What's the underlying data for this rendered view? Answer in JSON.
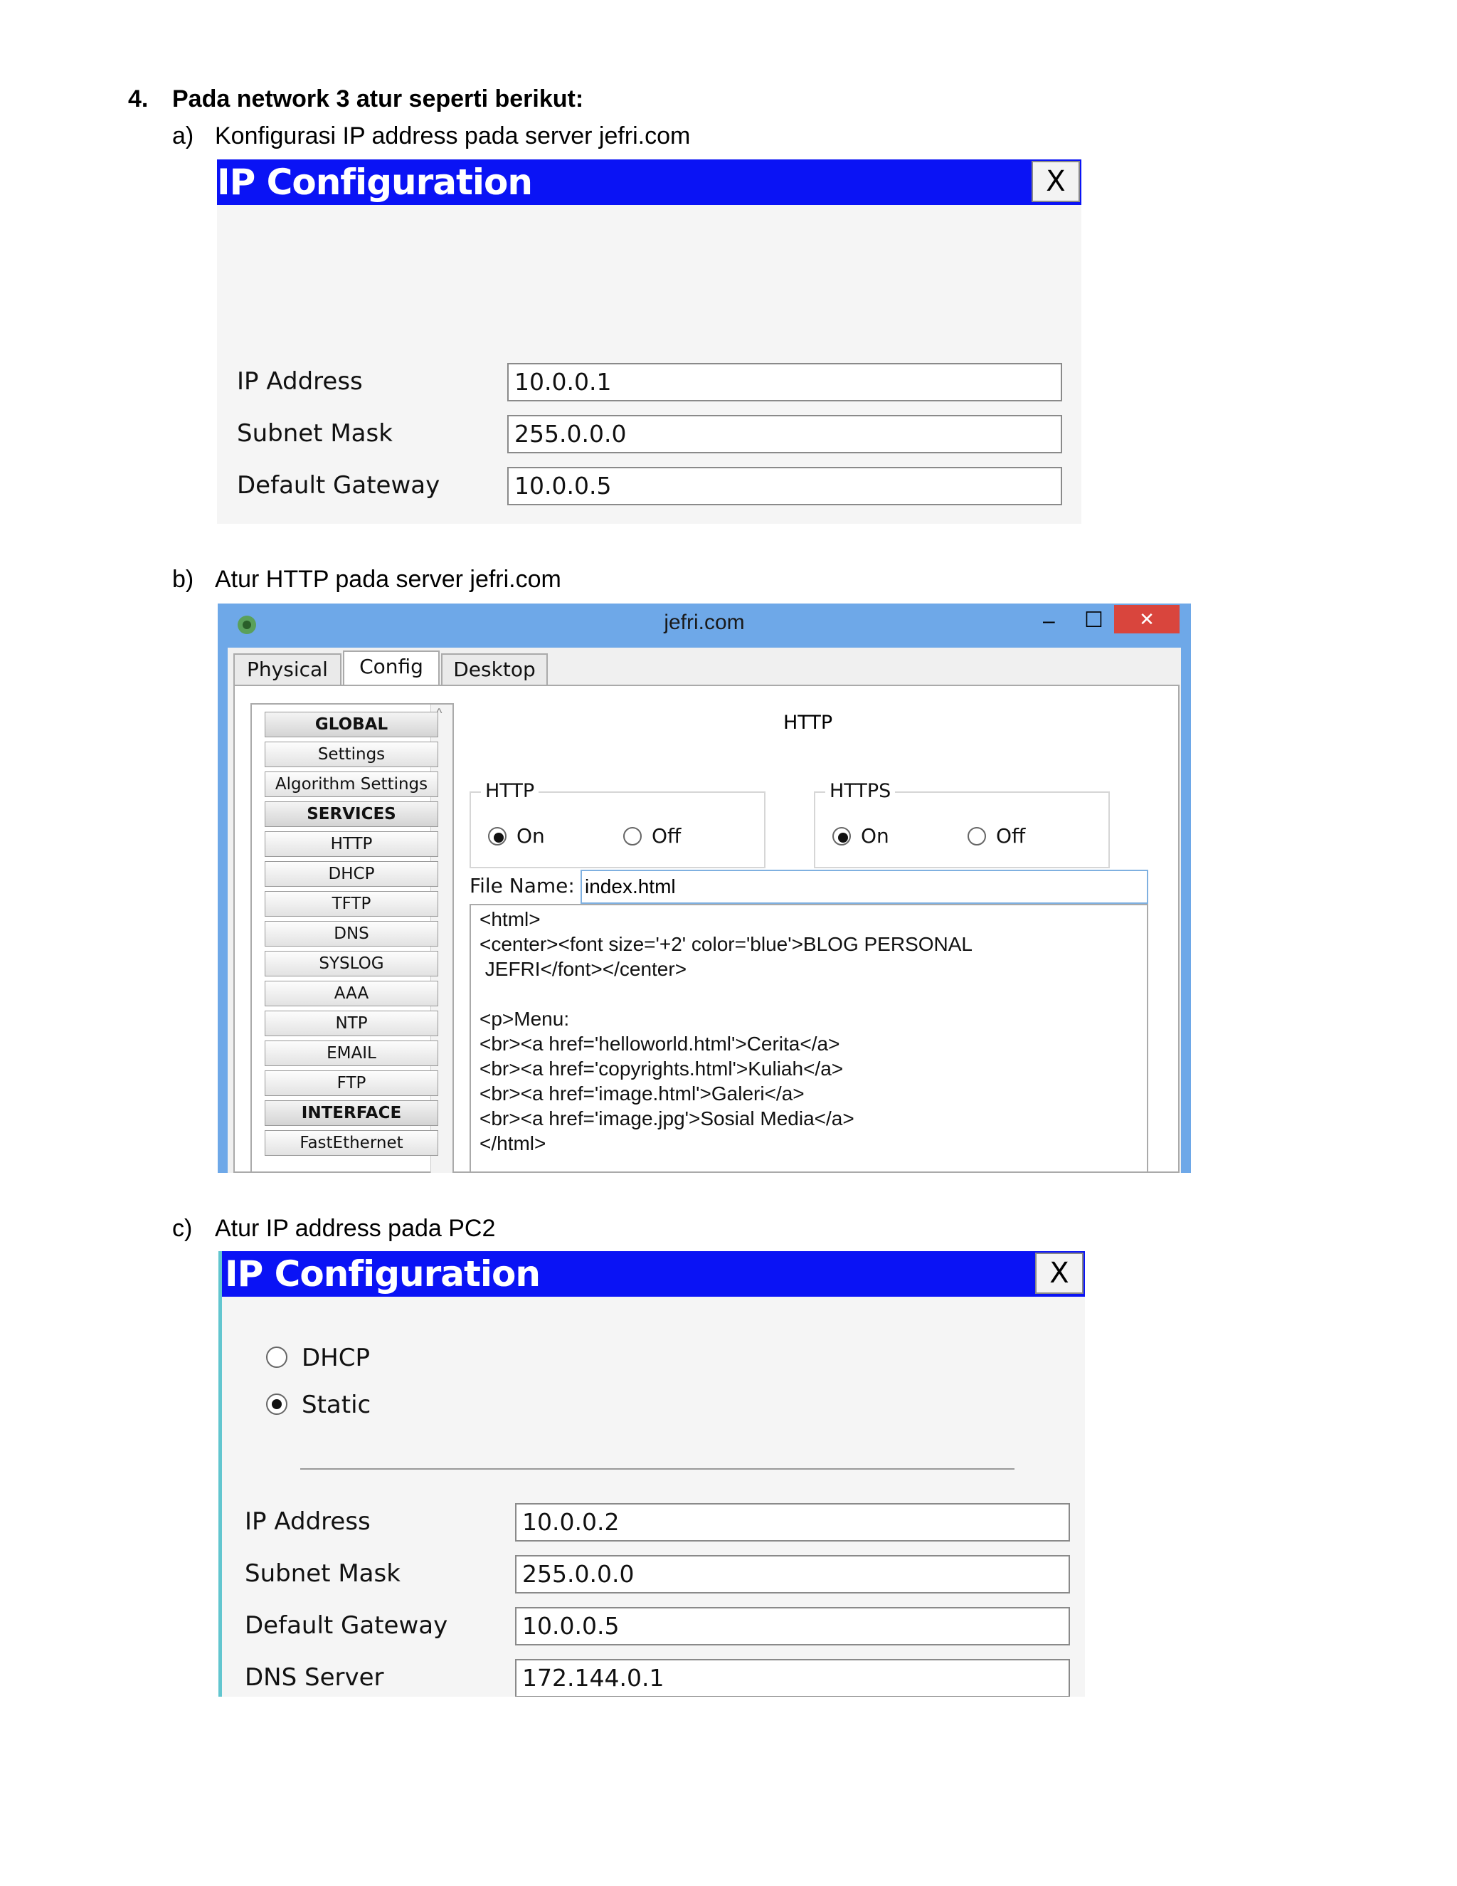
{
  "heading": {
    "number": "4.",
    "text": "Pada network 3 atur seperti berikut:"
  },
  "items": [
    {
      "letter": "a)",
      "text": "Konfigurasi IP address pada server jefri.com"
    },
    {
      "letter": "b)",
      "text": "Atur HTTP pada server jefri.com"
    },
    {
      "letter": "c)",
      "text": "Atur IP address pada PC2"
    }
  ],
  "ip_server": {
    "title": "IP Configuration",
    "close": "X",
    "fields": [
      {
        "label": "IP Address",
        "value": "10.0.0.1"
      },
      {
        "label": "Subnet Mask",
        "value": "255.0.0.0"
      },
      {
        "label": "Default Gateway",
        "value": "10.0.0.5"
      }
    ]
  },
  "pt_window": {
    "title": "jefri.com",
    "controls": {
      "minimize": "‒",
      "maximize": "☐",
      "close": "✕"
    },
    "tabs": [
      "Physical",
      "Config",
      "Desktop"
    ],
    "active_tab": "Config",
    "sidebar": [
      "GLOBAL",
      "Settings",
      "Algorithm Settings",
      "SERVICES",
      "HTTP",
      "DHCP",
      "TFTP",
      "DNS",
      "SYSLOG",
      "AAA",
      "NTP",
      "EMAIL",
      "FTP",
      "INTERFACE",
      "FastEthernet"
    ],
    "panel_title": "HTTP",
    "http": {
      "label": "HTTP",
      "on": "On",
      "off": "Off",
      "selected": "On"
    },
    "https": {
      "label": "HTTPS",
      "on": "On",
      "off": "Off",
      "selected": "On"
    },
    "file_name_label": "File Name:",
    "file_name": "index.html",
    "code_lines": [
      "<html>",
      "<center><font size='+2' color='blue'>BLOG PERSONAL",
      " JEFRI</font></center>",
      "",
      "<p>Menu:",
      "<br><a href='helloworld.html'>Cerita</a>",
      "<br><a href='copyrights.html'>Kuliah</a>",
      "<br><a href='image.html'>Galeri</a>",
      "<br><a href='image.jpg'>Sosial Media</a>",
      "</html>"
    ]
  },
  "ip_pc2": {
    "title": "IP Configuration",
    "close": "X",
    "mode": {
      "dhcp": "DHCP",
      "static": "Static",
      "selected": "Static"
    },
    "fields": [
      {
        "label": "IP Address",
        "value": "10.0.0.2"
      },
      {
        "label": "Subnet Mask",
        "value": "255.0.0.0"
      },
      {
        "label": "Default Gateway",
        "value": "10.0.0.5"
      },
      {
        "label": "DNS Server",
        "value": "172.144.0.1"
      }
    ]
  },
  "colors": {
    "titlebar_blue": "#0a13f5",
    "window_blue": "#6ea8e8"
  }
}
